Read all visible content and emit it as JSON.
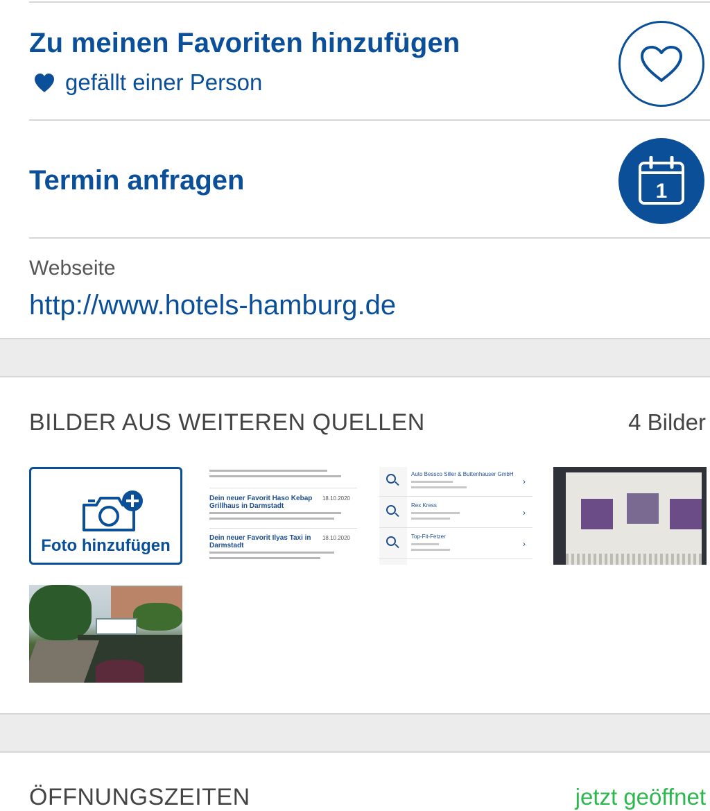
{
  "favorites": {
    "title": "Zu meinen Favoriten hinzufügen",
    "likes_text": "gefällt einer Person"
  },
  "appointment": {
    "title": "Termin anfragen",
    "calendar_day": "1"
  },
  "website": {
    "label": "Webseite",
    "url": "http://www.hotels-hamburg.de"
  },
  "images": {
    "section_title": "BILDER AUS WEITEREN QUELLEN",
    "count_text": "4 Bilder",
    "add_photo_label": "Foto hinzufügen",
    "thumb2": {
      "items": [
        {
          "title": "Dein neuer Favorit Haso Kebap Grillhaus in Darmstadt",
          "date": "18.10.2020"
        },
        {
          "title": "Dein neuer Favorit Ilyas Taxi in Darmstadt",
          "date": "18.10.2020"
        }
      ]
    },
    "thumb3": {
      "items": [
        {
          "name": "Auto Bessco Siller & Buttenhauser GmbH"
        },
        {
          "name": "Rex Kress"
        },
        {
          "name": "Top-Fit-Fetzer"
        }
      ]
    }
  },
  "hours": {
    "section_title": "ÖFFNUNGSZEITEN",
    "status": "jetzt geöffnet"
  },
  "colors": {
    "accent": "#0a4f97",
    "open_status": "#2db84d",
    "divider": "#d6d6d6",
    "gap_background": "#ececec"
  },
  "icons": {
    "favorite_button": "heart-outline-icon",
    "likes": "heart-filled-icon",
    "appointment_button": "calendar-icon",
    "add_photo": "camera-plus-icon"
  }
}
